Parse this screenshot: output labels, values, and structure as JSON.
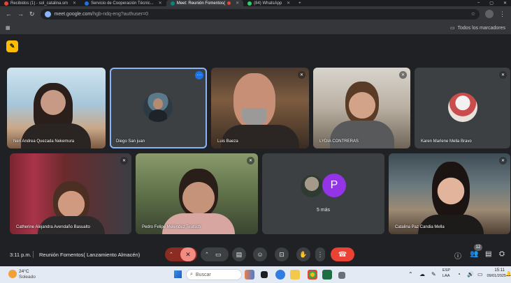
{
  "browser": {
    "tabs": [
      {
        "label": "Recibidos (1) - sol_catalina.sm",
        "color": "#ea4335",
        "active": false
      },
      {
        "label": "Servicio de Cooperación Técnic...",
        "color": "#1a73e8",
        "active": false
      },
      {
        "label": "Meet: Reunión Fomentos(",
        "color": "#00897b",
        "active": true
      },
      {
        "label": "(84) WhatsApp",
        "color": "#25d366",
        "active": false
      }
    ],
    "new_tab": "+",
    "url_host": "meet.google.com",
    "url_path": "/hgb-ndq-eng?authuser=0",
    "bookmarks_folder": "Todos los marcadores"
  },
  "meeting": {
    "time": "3:11 p.m.",
    "title": "Reunión Fomentos( Lanzamiento Almacén)",
    "participants_count": "12",
    "others_label": "5 más",
    "others_avatar_letter": "P",
    "participants": [
      {
        "name": "Neri Andrea Quezada Nekemura",
        "muted": false
      },
      {
        "name": "Diego San juan",
        "muted": false
      },
      {
        "name": "Luis Baeza",
        "muted": true
      },
      {
        "name": "LYDIA CONTRERAS",
        "muted": true
      },
      {
        "name": "Karen Marlene Mella Bravo",
        "muted": true
      },
      {
        "name": "Catherine Alejandra Avendaño Basualto",
        "muted": true
      },
      {
        "name": "Pedro Felipe Meléndez Teutsch",
        "muted": true
      },
      {
        "name": "Catalina Paz Candia Mella",
        "muted": true
      }
    ]
  },
  "taskbar": {
    "weather_temp": "24°C",
    "weather_desc": "Soleado",
    "search_placeholder": "Buscar",
    "lang_top": "ESP",
    "lang_bottom": "LAA",
    "clock_time": "15:11",
    "clock_date": "09/01/2025"
  },
  "colors": {
    "meet_bg": "#202124",
    "tile_bg": "#3c4043",
    "hangup_red": "#ea4335",
    "caption_yellow": "#fbbc04",
    "avatar_purple": "#9334e6"
  }
}
